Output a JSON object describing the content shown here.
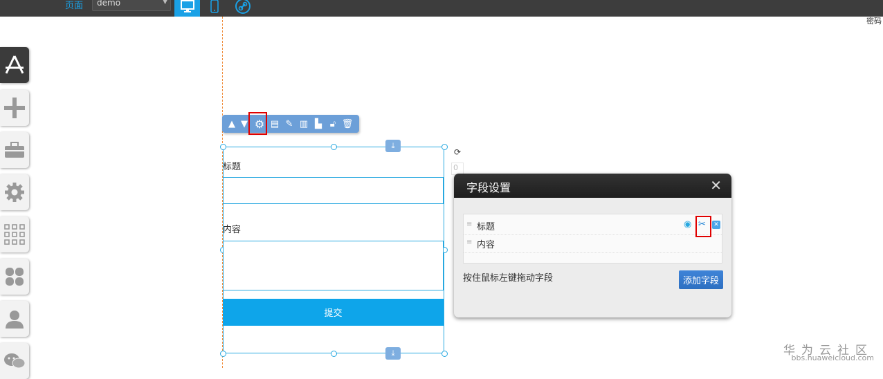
{
  "topbar": {
    "page_label": "页面",
    "page_select_value": "demo",
    "devices": [
      "desktop-icon",
      "mobile-icon",
      "link-icon"
    ],
    "accent": "#1aa1e6",
    "top_right_text": "密码"
  },
  "sidebar": {
    "items": [
      {
        "icon": "app-store-icon",
        "active": true
      },
      {
        "icon": "plus-icon"
      },
      {
        "icon": "toolbox-icon"
      },
      {
        "icon": "gear-icon"
      },
      {
        "icon": "grid-icon"
      },
      {
        "icon": "clover-icon"
      },
      {
        "icon": "user-icon"
      },
      {
        "icon": "wechat-icon"
      }
    ]
  },
  "toolbar": {
    "icons": [
      "move-up-icon",
      "move-down-icon",
      "settings-icon",
      "form-settings-icon",
      "edit-icon",
      "columns-icon",
      "chart-icon",
      "lock-icon",
      "delete-icon"
    ]
  },
  "form": {
    "field1_label": "标题",
    "field2_label": "内容",
    "submit_label": "提交",
    "small_box": "0"
  },
  "dialog": {
    "title": "字段设置",
    "fields": [
      {
        "label": "标题"
      },
      {
        "label": "内容"
      }
    ],
    "hint": "按住鼠标左键拖动字段",
    "add_button": "添加字段"
  },
  "watermark": {
    "text": "华为云社区",
    "url": "bbs.huaweicloud.com"
  }
}
